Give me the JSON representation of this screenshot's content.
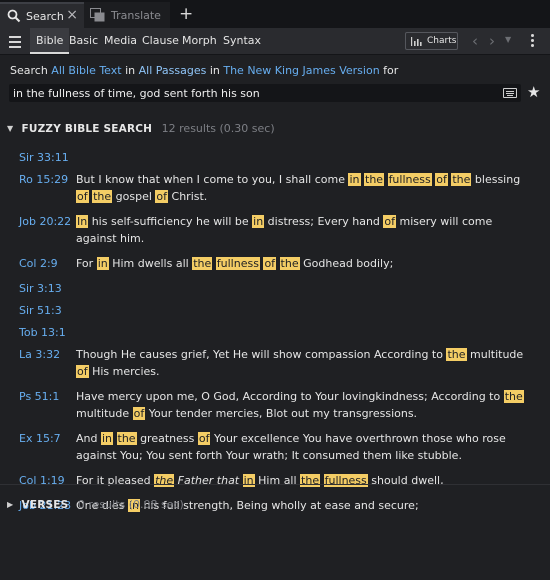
{
  "tabs": [
    {
      "label": "Search",
      "active": true
    },
    {
      "label": "Translate",
      "active": false
    }
  ],
  "menu_tabs": [
    "Bible",
    "Basic",
    "Media",
    "Clause",
    "Morph",
    "Syntax"
  ],
  "toolbar": {
    "charts_label": "Charts"
  },
  "search": {
    "prefix": "Search",
    "scope_text": "All Bible Text",
    "in1": "in",
    "passages": "All Passages",
    "in2": "in",
    "version": "The New King James Version",
    "for": "for",
    "query": "in the fullness of time, god sent forth his son"
  },
  "fuzzy": {
    "title": "FUZZY BIBLE SEARCH",
    "count": "12 results (0.30 sec)"
  },
  "verses_section": {
    "title": "VERSES",
    "count": "0 results (0.08 sec)"
  },
  "results": [
    {
      "ref": "Sir 33:11",
      "segments": []
    },
    {
      "ref": "Ro 15:29",
      "segments": [
        {
          "t": "But I know that when I come to you, I shall come "
        },
        {
          "t": "in",
          "h": true
        },
        {
          "t": " "
        },
        {
          "t": "the",
          "h": true
        },
        {
          "t": " "
        },
        {
          "t": "fullness",
          "h": true
        },
        {
          "t": " "
        },
        {
          "t": "of",
          "h": true
        },
        {
          "t": " "
        },
        {
          "t": "the",
          "h": true
        },
        {
          "t": " blessing "
        },
        {
          "t": "of",
          "h": true
        },
        {
          "t": " "
        },
        {
          "t": "the",
          "h": true
        },
        {
          "t": " gospel "
        },
        {
          "t": "of",
          "h": true
        },
        {
          "t": " Christ."
        }
      ]
    },
    {
      "ref": "Job 20:22",
      "segments": [
        {
          "t": "In",
          "h": true
        },
        {
          "t": " his self-sufficiency he will be "
        },
        {
          "t": "in",
          "h": true
        },
        {
          "t": " distress; Every hand "
        },
        {
          "t": "of",
          "h": true
        },
        {
          "t": " misery will come against him."
        }
      ]
    },
    {
      "ref": "Col 2:9",
      "segments": [
        {
          "t": "For "
        },
        {
          "t": "in",
          "h": true
        },
        {
          "t": " Him dwells all "
        },
        {
          "t": "the",
          "h": true
        },
        {
          "t": " "
        },
        {
          "t": "fullness",
          "h": true
        },
        {
          "t": " "
        },
        {
          "t": "of",
          "h": true
        },
        {
          "t": " "
        },
        {
          "t": "the",
          "h": true
        },
        {
          "t": " Godhead bodily;"
        }
      ]
    },
    {
      "ref": "Sir 3:13",
      "segments": []
    },
    {
      "ref": "Sir 51:3",
      "segments": []
    },
    {
      "ref": "Tob 13:1",
      "segments": []
    },
    {
      "ref": "La 3:32",
      "segments": [
        {
          "t": "Though He causes grief, Yet He will show compassion According to "
        },
        {
          "t": "the",
          "h": true
        },
        {
          "t": " multitude "
        },
        {
          "t": "of",
          "h": true
        },
        {
          "t": " His mercies."
        }
      ]
    },
    {
      "ref": "Ps 51:1",
      "segments": [
        {
          "t": "Have mercy upon me, O God, According to Your lovingkindness; According to "
        },
        {
          "t": "the",
          "h": true
        },
        {
          "t": " multitude "
        },
        {
          "t": "of",
          "h": true
        },
        {
          "t": " Your tender mercies, Blot out my transgressions."
        }
      ]
    },
    {
      "ref": "Ex 15:7",
      "segments": [
        {
          "t": "And "
        },
        {
          "t": "in",
          "h": true
        },
        {
          "t": " "
        },
        {
          "t": "the",
          "h": true
        },
        {
          "t": " greatness "
        },
        {
          "t": "of",
          "h": true
        },
        {
          "t": " Your excellence You have overthrown those who rose against You; You sent forth Your wrath; It consumed them like stubble."
        }
      ]
    },
    {
      "ref": "Col 1:19",
      "segments": [
        {
          "t": "For it pleased "
        },
        {
          "t": "the",
          "h": true,
          "i": true
        },
        {
          "t": " "
        },
        {
          "t": "Father that",
          "i": true
        },
        {
          "t": " "
        },
        {
          "t": "in",
          "h": true
        },
        {
          "t": " Him all "
        },
        {
          "t": "the",
          "h": true
        },
        {
          "t": " "
        },
        {
          "t": "fullness",
          "h": true
        },
        {
          "t": " should dwell,"
        }
      ]
    },
    {
      "ref": "Job 21:23",
      "segments": [
        {
          "t": "One dies "
        },
        {
          "t": "in",
          "h": true
        },
        {
          "t": " his full strength, Being wholly at ease and secure;"
        }
      ]
    }
  ],
  "colors": {
    "link": "#67aef0",
    "highlight": "#f4cd65",
    "background": "#1f2023"
  },
  "icons": [
    "search-icon",
    "close-icon",
    "translate-icon",
    "plus-icon",
    "menu-icon",
    "chart-icon",
    "back-icon",
    "forward-icon",
    "chevron-down-icon",
    "more-icon",
    "keyboard-icon",
    "star-icon",
    "collapse-caret-icon",
    "expand-caret-icon"
  ]
}
